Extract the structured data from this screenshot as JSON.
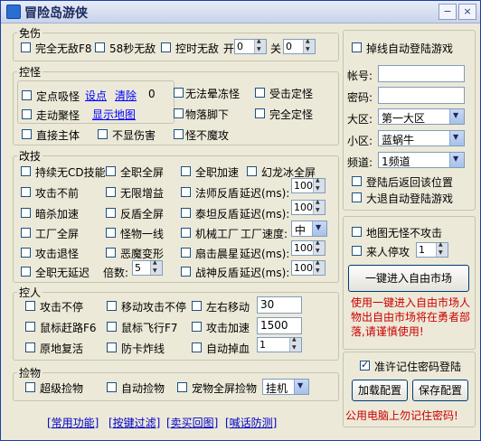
{
  "window": {
    "title": "冒险岛游侠",
    "minimize": "−",
    "close": "×"
  },
  "invincible": {
    "title": "免伤",
    "full_invincible": "完全无敌F8",
    "sec58_invincible": "58秒无敌",
    "timed_invincible": "控时无敌",
    "on_label": "开",
    "on_value": "0",
    "off_label": "关",
    "off_value": "0"
  },
  "monster_control": {
    "title": "控怪",
    "fixed_suction": "定点吸怪",
    "set_point": "设点",
    "clear": "清除",
    "count": "0",
    "walk_gather": "走动聚怪",
    "show_map": "显示地图",
    "direct_hit": "直接主体",
    "no_damage_display": "不显伤害",
    "no_stun": "无法晕冻怪",
    "hit_fixed": "受击定怪",
    "drop_under_feet": "物落脚下",
    "full_fixed": "完全定怪",
    "monster_no_attack": "怪不魔攻"
  },
  "skill_mod": {
    "title": "改技",
    "persistent_cd": "持续无CD技能",
    "all_class_fullscreen": "全职全屏",
    "all_class_speedup": "全职加速",
    "phantom_ice": "幻龙冰全屏",
    "no_forward_attack": "攻击不前",
    "unlimited_buff": "无限增益",
    "mage_rebound": "法师反盾",
    "delay_label": "延迟(ms):",
    "mage_delay": "100",
    "dark_attack_speed": "暗杀加速",
    "rebound_fullscreen": "反盾全屏",
    "taile_rebound": "泰坦反盾",
    "taile_delay": "100",
    "factory_fullscreen": "工厂全屏",
    "monster_line": "怪物一线",
    "mech_factory": "机械工厂",
    "factory_speed_label": "工厂速度:",
    "factory_speed": "中",
    "attack_retreat": "攻击退怪",
    "demon_transform": "恶魔变形",
    "fan_cloud": "扇击晨星",
    "fan_delay": "100",
    "all_class_no_delay": "全职无延迟",
    "multiplier_label": "倍数:",
    "multiplier": "5",
    "war_god_rebound": "战神反盾",
    "war_delay": "100"
  },
  "character": {
    "title": "控人",
    "attack_nonstop": "攻击不停",
    "move_attack_nonstop": "移动攻击不停",
    "left_right_move": "左右移动",
    "move_value": "30",
    "mouse_chase": "鼠标赶路F6",
    "mouse_fly": "鼠标飞行F7",
    "attack_speed": "攻击加速",
    "speed_value": "1500",
    "revive_in_place": "原地复活",
    "anti_lag": "防卡炸线",
    "auto_drop_blood": "自动掉血",
    "blood_value": "1"
  },
  "pickup": {
    "title": "捡物",
    "super_pickup": "超级捡物",
    "auto_pickup": "自动捡物",
    "pet_fullscreen": "宠物全屏捡物",
    "mode": "挂机"
  },
  "login": {
    "auto_relogin": "掉线自动登陆游戏",
    "account_label": "帐号:",
    "password_label": "密码:",
    "region_label": "大区:",
    "region_value": "第一大区",
    "subregion_label": "小区:",
    "subregion_value": "蓝蜗牛",
    "channel_label": "频道:",
    "channel_value": "1频道",
    "return_position": "登陆后返回该位置",
    "exit_relogin": "大退自动登陆游戏"
  },
  "market": {
    "map_no_attack": "地图无怪不攻击",
    "someone_stop": "来人停攻",
    "stop_value": "1",
    "enter_button": "一键进入自由市场",
    "warning": "使用一键进入自由市场人物出自由市场将在勇者部落,请谨慎使用!"
  },
  "password_box": {
    "allow_remember": "准许记住密码登陆",
    "allow_checked": true,
    "load_button": "加载配置",
    "save_button": "保存配置",
    "public_warning": "公用电脑上勿记住密码!"
  },
  "bottom_links": [
    "[常用功能]",
    "[按键过滤]",
    "[卖买回图]",
    "[喊话防测]"
  ]
}
